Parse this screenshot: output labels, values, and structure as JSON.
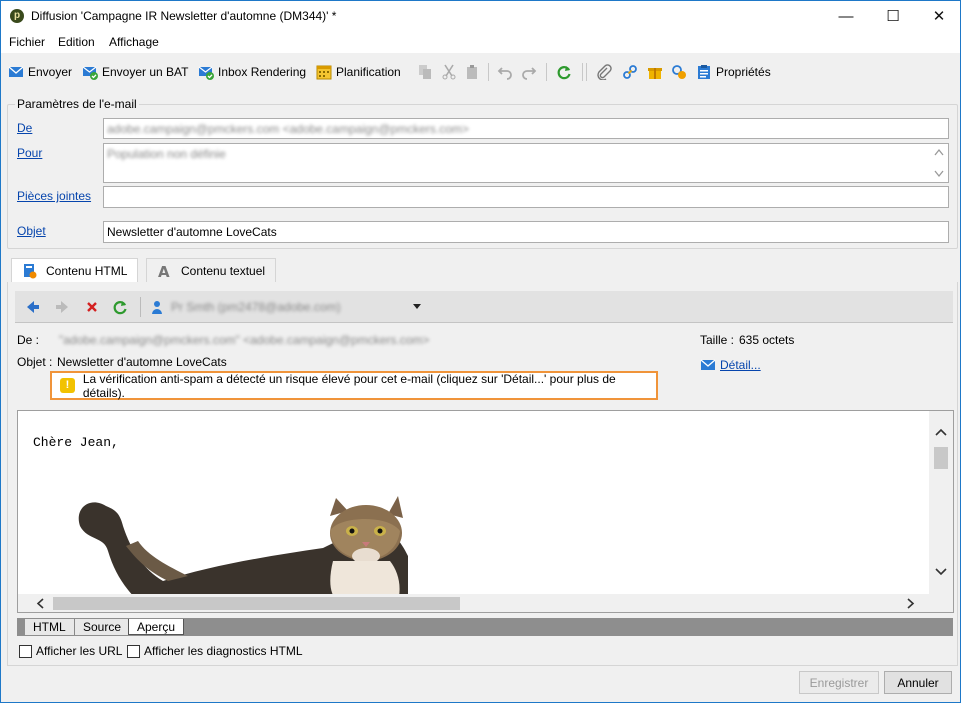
{
  "window": {
    "title": "Diffusion 'Campagne IR Newsletter d'automne (DM344)' *",
    "app_icon_glyph": "p",
    "controls": {
      "minimize": "—",
      "maximize": "☐",
      "close": "✕"
    }
  },
  "menu": [
    {
      "label": "Fichier"
    },
    {
      "label": "Edition"
    },
    {
      "label": "Affichage"
    }
  ],
  "toolbar": {
    "envoyer": "Envoyer",
    "envoyer_bat": "Envoyer un BAT",
    "inbox_rendering": "Inbox Rendering",
    "planification": "Planification",
    "proprietes": "Propriétés"
  },
  "email_params": {
    "group_title": "Paramètres de l'e-mail",
    "de_label": "De",
    "de_value": "adobe.campaign@pmckers.com <adobe.campaign@pmckers.com>",
    "pour_label": "Pour",
    "pour_value": "Population non définie",
    "pj_label": "Pièces jointes",
    "pj_value": "",
    "objet_label": "Objet",
    "objet_value": "Newsletter d'automne LoveCats"
  },
  "content_tabs": [
    {
      "label": "Contenu HTML",
      "icon": "html-content-icon",
      "active": true
    },
    {
      "label": "Contenu textuel",
      "icon": "text-content-icon",
      "active": false
    }
  ],
  "preview_nav": {
    "recipient": "Pr Smth (pm2478@adobe.com)"
  },
  "preview_header": {
    "de_label": "De :",
    "de_value": "\"adobe.campaign@pmckers.com\" <adobe.campaign@pmckers.com>",
    "objet_label": "Objet :",
    "objet_value": "Newsletter d'automne LoveCats",
    "taille_label": "Taille :",
    "taille_value": "635 octets",
    "detail_link": "Détail..."
  },
  "warning": {
    "icon": "!",
    "text": "La vérification anti-spam a détecté un risque élevé pour cet e-mail (cliquez sur 'Détail...' pour plus de détails)."
  },
  "preview": {
    "greeting": "Chère Jean,"
  },
  "view_tabs": [
    {
      "label": "HTML",
      "active": false
    },
    {
      "label": "Source",
      "active": false
    },
    {
      "label": "Aperçu",
      "active": true
    }
  ],
  "options": {
    "show_urls": "Afficher les URL",
    "show_diagnostics": "Afficher les diagnostics HTML"
  },
  "buttons": {
    "save": "Enregistrer",
    "cancel": "Annuler"
  },
  "colors": {
    "warning_border": "#f0943a",
    "link": "#0645ad",
    "accent": "#1e78c8"
  }
}
